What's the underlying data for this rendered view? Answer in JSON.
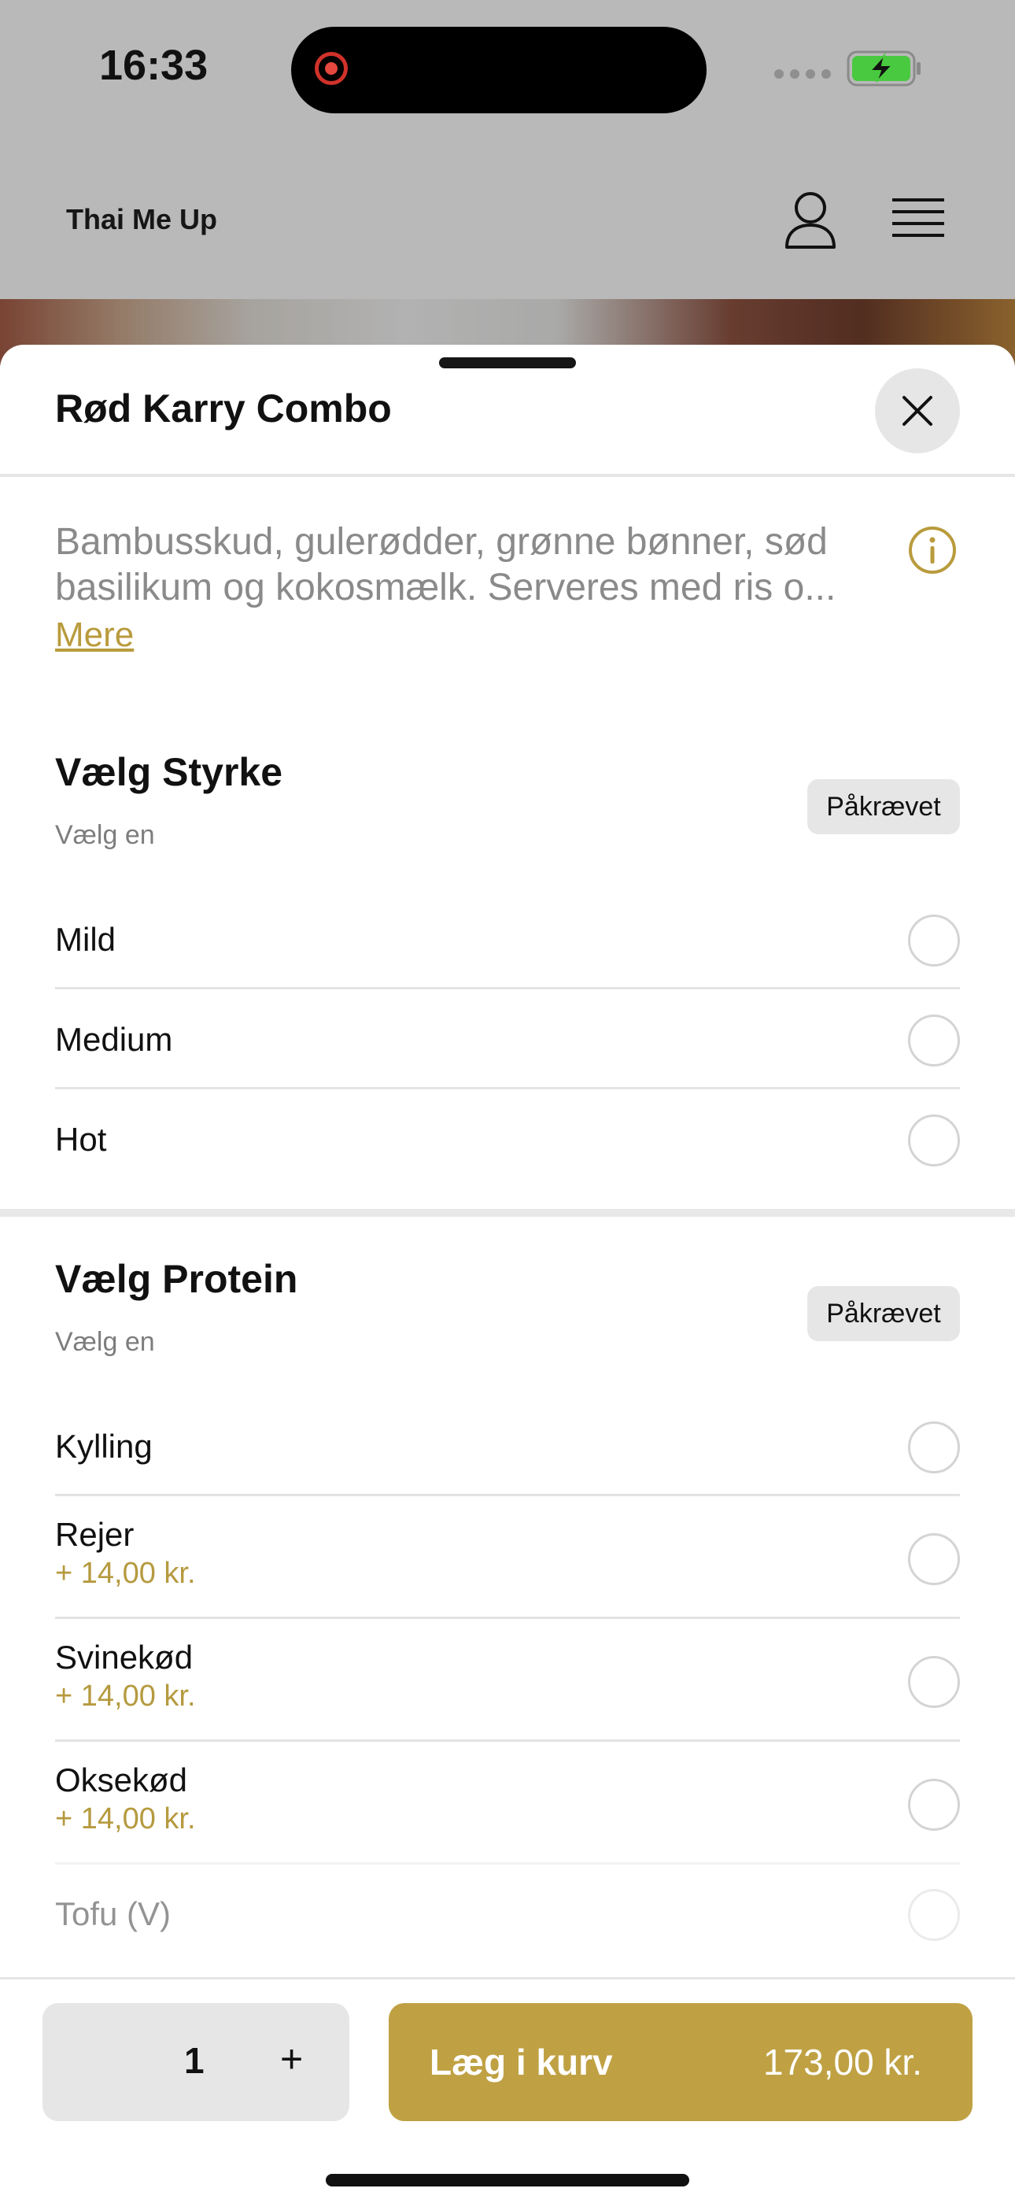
{
  "status_bar": {
    "time": "16:33",
    "battery_color": "#49c93f"
  },
  "background_header": {
    "title": "Thai Me Up",
    "icons": [
      "person-icon",
      "menu-icon"
    ]
  },
  "sheet": {
    "title": "Rød Karry Combo",
    "description_lines": [
      "Bambusskud, gulerødder, grønne bønner, sød",
      "basilikum og kokosmælk. Serveres med ris o..."
    ],
    "more_link": "Mere",
    "accent_color": "#bfa144"
  },
  "sections": [
    {
      "title": "Vælg Styrke",
      "subtitle": "Vælg en",
      "badge": "Påkrævet",
      "options": [
        {
          "label": "Mild",
          "price": ""
        },
        {
          "label": "Medium",
          "price": ""
        },
        {
          "label": "Hot",
          "price": ""
        }
      ]
    },
    {
      "title": "Vælg Protein",
      "subtitle": "Vælg en",
      "badge": "Påkrævet",
      "options": [
        {
          "label": "Kylling",
          "price": ""
        },
        {
          "label": "Rejer",
          "price": "+ 14,00 kr."
        },
        {
          "label": "Svinekød",
          "price": "+ 14,00 kr."
        },
        {
          "label": "Oksekød",
          "price": "+ 14,00 kr."
        },
        {
          "label": "Tofu (V)",
          "price": ""
        }
      ]
    }
  ],
  "bottom_bar": {
    "quantity": "1",
    "plus_label": "+",
    "add_label": "Læg i kurv",
    "total_price": "173,00 kr."
  }
}
